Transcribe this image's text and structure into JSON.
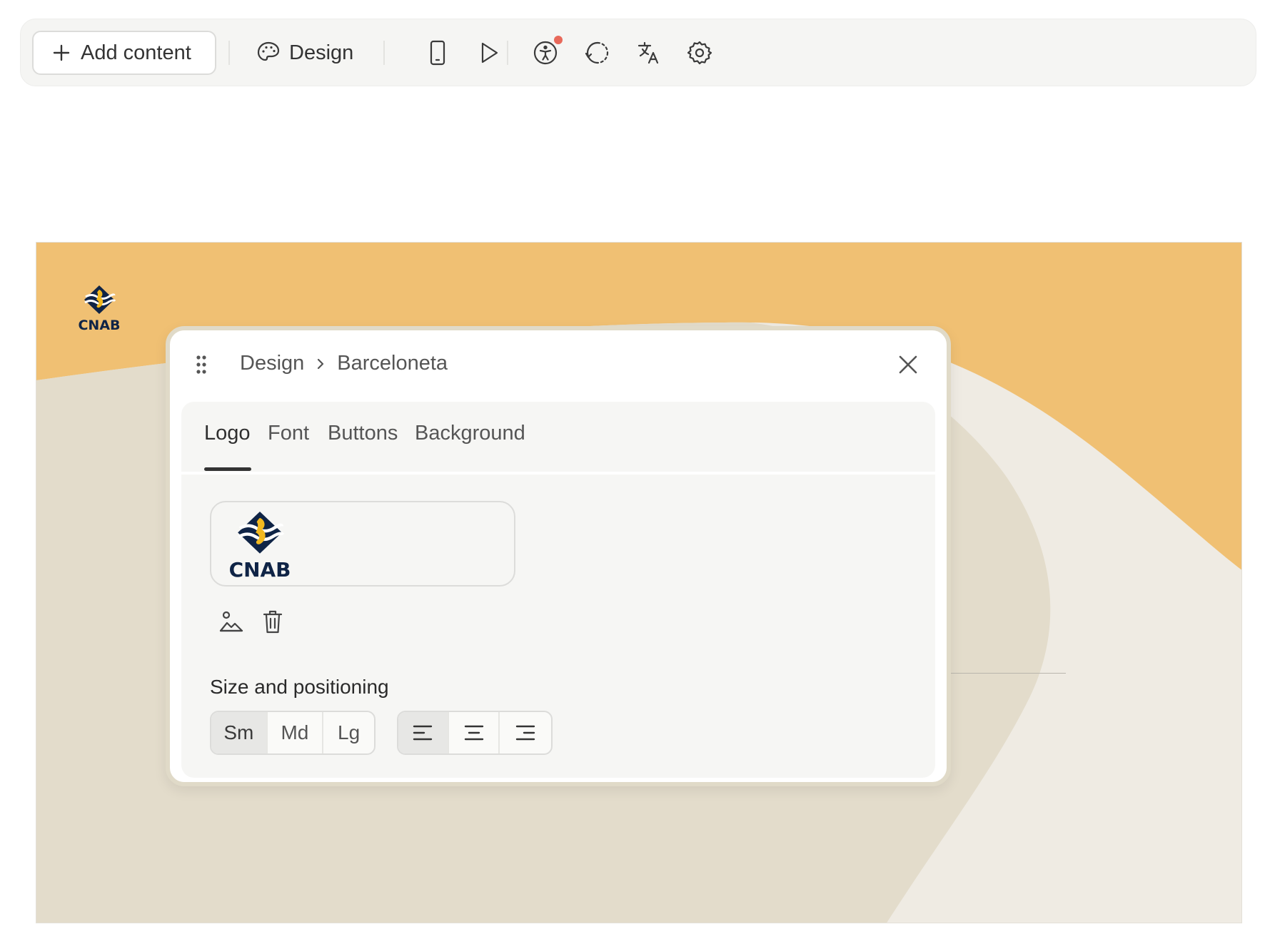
{
  "toolbar": {
    "add_content_label": "Add content",
    "design_label": "Design",
    "icons": [
      "plus-icon",
      "palette-icon",
      "mobile-preview-icon",
      "play-icon",
      "accessibility-icon",
      "history-icon",
      "translate-icon",
      "settings-icon"
    ],
    "notification_color": "#e8695a"
  },
  "canvas": {
    "logo_text": "CNAB",
    "colors": {
      "orange": "#f0c073",
      "beige_dark": "#e3dccb",
      "beige_light": "#efebe3"
    }
  },
  "panel": {
    "breadcrumb": {
      "parent": "Design",
      "current": "Barceloneta"
    },
    "tabs": [
      {
        "label": "Logo",
        "active": true
      },
      {
        "label": "Font",
        "active": false
      },
      {
        "label": "Buttons",
        "active": false
      },
      {
        "label": "Background",
        "active": false
      }
    ],
    "logo": {
      "text": "CNAB",
      "colors": {
        "navy": "#0f2446",
        "gold": "#f2b920"
      }
    },
    "actions": [
      "image-upload-icon",
      "trash-icon"
    ],
    "size_section": {
      "title": "Size and positioning",
      "sizes": [
        {
          "label": "Sm",
          "selected": true
        },
        {
          "label": "Md",
          "selected": false
        },
        {
          "label": "Lg",
          "selected": false
        }
      ],
      "alignments": [
        {
          "icon": "align-left-icon",
          "selected": true
        },
        {
          "icon": "align-center-icon",
          "selected": false
        },
        {
          "icon": "align-right-icon",
          "selected": false
        }
      ]
    }
  }
}
